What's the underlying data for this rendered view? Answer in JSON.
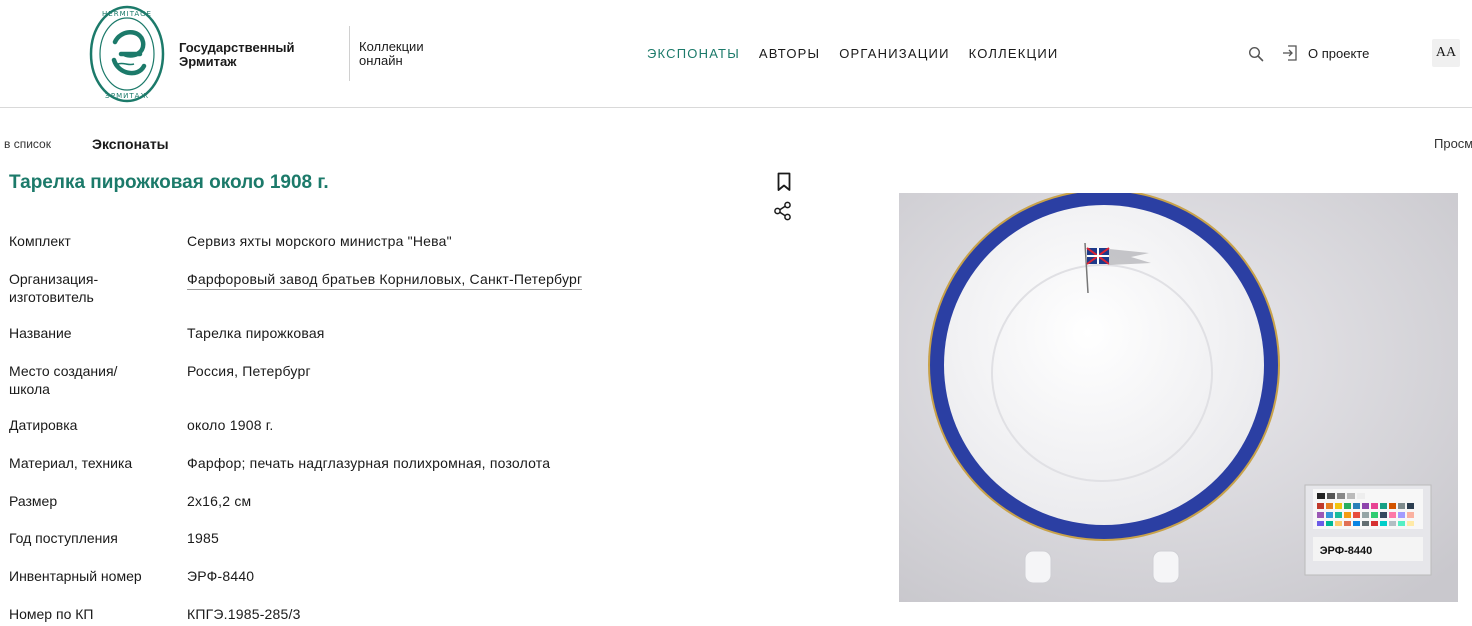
{
  "header": {
    "brand_line1": "Государственный",
    "brand_line2": "Эрмитаж",
    "collections_line1": "Коллекции",
    "collections_line2": "онлайн",
    "logo_text_top": "HERMITAGE",
    "logo_text_bottom": "ЭРМИТАЖ",
    "nav": [
      {
        "label": "ЭКСПОНАТЫ",
        "active": true
      },
      {
        "label": "АВТОРЫ",
        "active": false
      },
      {
        "label": "ОРГАНИЗАЦИИ",
        "active": false
      },
      {
        "label": "КОЛЛЕКЦИИ",
        "active": false
      }
    ],
    "about_label": "О проекте",
    "font_size_label": "AA",
    "accent_color": "#1c7a6a"
  },
  "breadcrumb": {
    "back_label": "в список",
    "current": "Экспонаты",
    "view_label": "Просм"
  },
  "item": {
    "title": "Тарелка пирожковая около 1908 г.",
    "fields": [
      {
        "label": "Комплект",
        "value": "Сервиз яхты морского министра \"Нева\"",
        "link": false
      },
      {
        "label": "Организация-изготовитель",
        "value": "Фарфоровый завод братьев Корниловых, Санкт-Петербург",
        "link": true
      },
      {
        "label": "Название",
        "value": "Тарелка пирожковая",
        "link": false
      },
      {
        "label": "Место создания/ школа",
        "value": "Россия, Петербург",
        "link": false
      },
      {
        "label": "Датировка",
        "value": "около 1908 г.",
        "link": false
      },
      {
        "label": "Материал, техника",
        "value": "Фарфор; печать надглазурная полихромная, позолота",
        "link": false
      },
      {
        "label": "Размер",
        "value": "2x16,2 см",
        "link": false
      },
      {
        "label": "Год поступления",
        "value": "1985",
        "link": false
      },
      {
        "label": "Инвентарный номер",
        "value": "ЭРФ-8440",
        "link": false
      },
      {
        "label": "Номер по КП",
        "value": "КПГЭ.1985-285/3",
        "link": false
      }
    ]
  },
  "photo": {
    "tag_label": "ЭРФ-8440"
  },
  "icons": [
    "search-icon",
    "login-icon",
    "bookmark-icon",
    "share-icon"
  ]
}
